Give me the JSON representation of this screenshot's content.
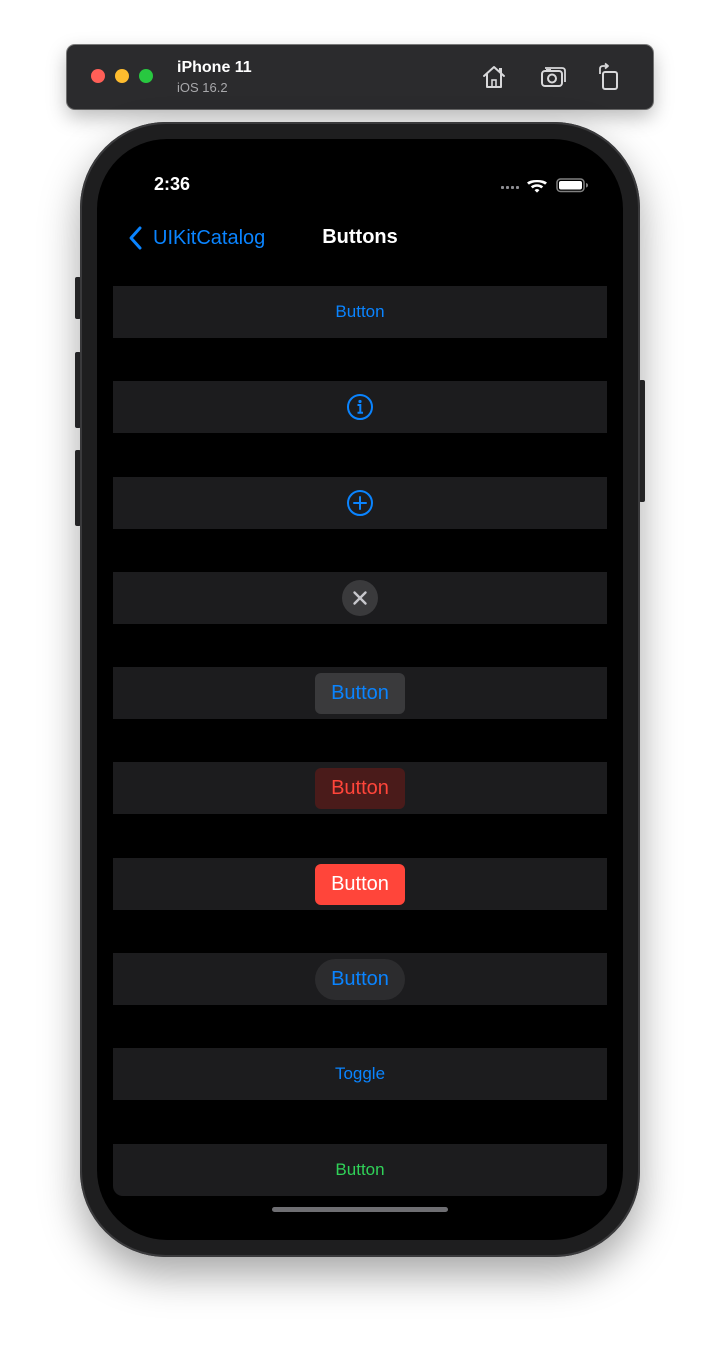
{
  "simulator": {
    "device_name": "iPhone 11",
    "os_version": "iOS 16.2",
    "icons": [
      "home-icon",
      "screenshot-icon",
      "rotate-icon"
    ]
  },
  "status_bar": {
    "time": "2:36",
    "icons": [
      "signal-icon",
      "wifi-icon",
      "battery-icon"
    ]
  },
  "nav": {
    "back_label": "UIKitCatalog",
    "title": "Buttons"
  },
  "buttons": {
    "system": "Button",
    "detail_icon": "info-circle-icon",
    "add_icon": "plus-circle-icon",
    "close_icon": "xmark-icon",
    "gray": "Button",
    "tinted": "Button",
    "filled": "Button",
    "capsule": "Button",
    "toggle": "Toggle",
    "green": "Button"
  },
  "colors": {
    "accent": "#0a84ff",
    "destructive": "#ff453a",
    "green": "#30d158",
    "row_background": "#1c1c1e",
    "screen_background": "#000000"
  }
}
